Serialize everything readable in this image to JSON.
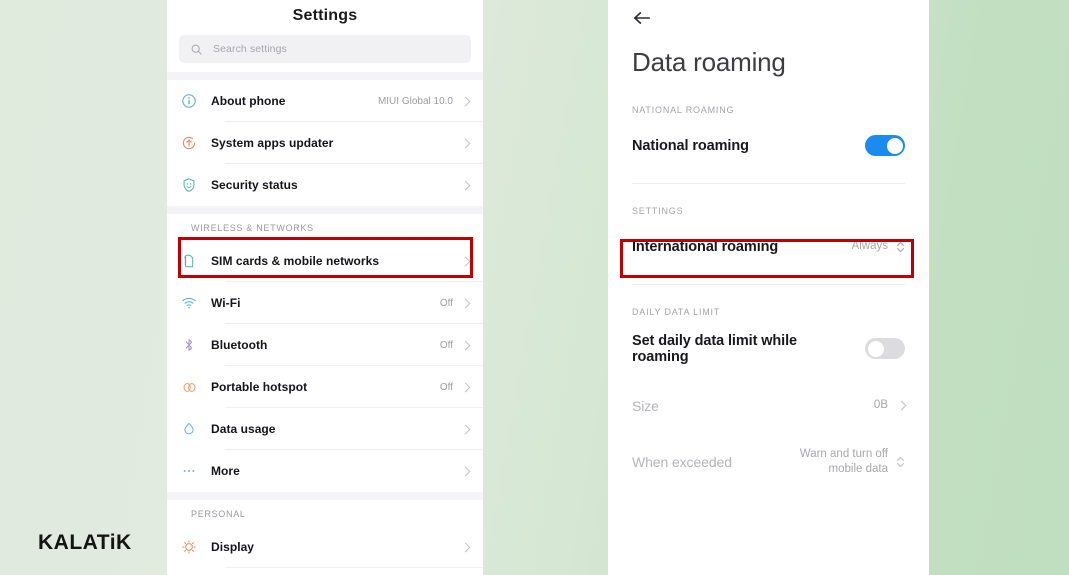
{
  "watermark": "KALATiK",
  "left_phone": {
    "title": "Settings",
    "search": {
      "placeholder": "Search settings",
      "icon": "search-icon"
    },
    "sections": [
      {
        "header": "",
        "items": [
          {
            "label": "About phone",
            "value": "MIUI Global 10.0",
            "icon": "info-icon",
            "icon_color": "#57a8d8"
          },
          {
            "label": "System apps updater",
            "value": "",
            "icon": "update-icon",
            "icon_color": "#e9895b"
          },
          {
            "label": "Security status",
            "value": "",
            "icon": "shield-icon",
            "icon_color": "#4fb3a5"
          }
        ]
      },
      {
        "header": "WIRELESS & NETWORKS",
        "items": [
          {
            "label": "SIM cards & mobile networks",
            "value": "",
            "icon": "sim-card-icon",
            "icon_color": "#4fb3a5",
            "highlighted": true
          },
          {
            "label": "Wi-Fi",
            "value": "Off",
            "icon": "wifi-icon",
            "icon_color": "#63b6e8"
          },
          {
            "label": "Bluetooth",
            "value": "Off",
            "icon": "bluetooth-icon",
            "icon_color": "#a98fd8"
          },
          {
            "label": "Portable hotspot",
            "value": "Off",
            "icon": "hotspot-icon",
            "icon_color": "#eda277"
          },
          {
            "label": "Data usage",
            "value": "",
            "icon": "data-usage-icon",
            "icon_color": "#63b6e8"
          },
          {
            "label": "More",
            "value": "",
            "icon": "more-icon",
            "icon_color": "#7ba9e0"
          }
        ]
      },
      {
        "header": "PERSONAL",
        "items": [
          {
            "label": "Display",
            "value": "",
            "icon": "brightness-icon",
            "icon_color": "#e9895b"
          }
        ]
      }
    ]
  },
  "right_phone": {
    "back_icon": "back-arrow-icon",
    "page_title": "Data roaming",
    "sections": [
      {
        "header": "NATIONAL ROAMING",
        "rows": [
          {
            "label": "National roaming",
            "control": "toggle",
            "toggle_state": "on",
            "value": ""
          }
        ]
      },
      {
        "header": "SETTINGS",
        "rows": [
          {
            "label": "International roaming",
            "control": "stepper",
            "value": "Always",
            "highlighted": true
          }
        ]
      },
      {
        "header": "DAILY DATA LIMIT",
        "rows": [
          {
            "label": "Set daily data limit while roaming",
            "control": "toggle",
            "toggle_state": "off",
            "value": ""
          },
          {
            "label": "Size",
            "control": "chevron",
            "value": "0B",
            "disabled": true
          },
          {
            "label": "When exceeded",
            "control": "stepper",
            "value": "Warn and turn off\nmobile data",
            "disabled": true
          }
        ]
      }
    ]
  },
  "colors": {
    "accent_blue": "#1a8cf0",
    "highlight_red": "#c00000",
    "background_green": "#dfe9dc"
  }
}
